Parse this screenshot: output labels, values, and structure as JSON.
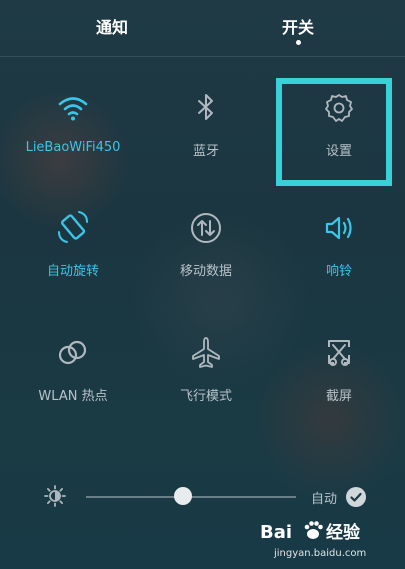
{
  "tabs": [
    {
      "label": "通知"
    },
    {
      "label": "开关"
    }
  ],
  "tiles": [
    {
      "label": "LieBaoWiFi450",
      "icon": "wifi-icon",
      "active": true
    },
    {
      "label": "蓝牙",
      "icon": "bluetooth-icon",
      "active": false
    },
    {
      "label": "设置",
      "icon": "gear-icon",
      "active": false
    },
    {
      "label": "自动旋转",
      "icon": "rotate-icon",
      "active": true
    },
    {
      "label": "移动数据",
      "icon": "mobile-data-icon",
      "active": false
    },
    {
      "label": "响铃",
      "icon": "ringer-icon",
      "active": true
    },
    {
      "label": "WLAN 热点",
      "icon": "hotspot-icon",
      "active": false
    },
    {
      "label": "飞行模式",
      "icon": "airplane-icon",
      "active": false
    },
    {
      "label": "截屏",
      "icon": "screenshot-icon",
      "active": false
    }
  ],
  "brightness": {
    "auto_label": "自动",
    "auto_enabled": true,
    "level": 0.46
  },
  "watermark": {
    "brand_text": "Bai经验",
    "url_text": "jingyan.baidu.com"
  },
  "colors": {
    "accent": "#39c6e8",
    "highlight": "#3ad0d8",
    "inactive": "#b8c2c8"
  }
}
